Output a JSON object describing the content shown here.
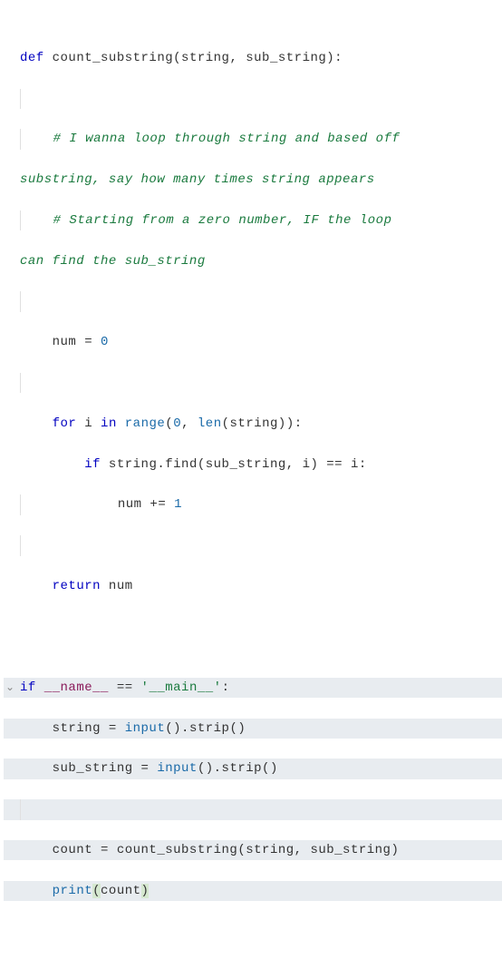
{
  "code": {
    "l1_def": "def",
    "l1_fn": " count_substring",
    "l1_rest": "(string, sub_string):",
    "l2": "",
    "l3a": "    ",
    "l3b": "# I wanna loop through string and based off",
    "l4a": "",
    "l4b": "substring, say how many times string appears",
    "l5a": "    ",
    "l5b": "# Starting from a zero number, IF the loop",
    "l6a": "",
    "l6b": "can find the sub_string",
    "l7": "",
    "l8a": "    num = ",
    "l8b": "0",
    "l9": "",
    "l10a": "    ",
    "l10_for": "for",
    "l10b": " i ",
    "l10_in": "in",
    "l10c": " ",
    "l10_range": "range",
    "l10d": "(",
    "l10e": "0",
    "l10f": ", ",
    "l10_len": "len",
    "l10g": "(string)):",
    "l11a": "        ",
    "l11_if": "if",
    "l11b": " string.find(sub_string, i) == i:",
    "l12a": "            num += ",
    "l12b": "1",
    "l13": "",
    "l14a": "    ",
    "l14_ret": "return",
    "l14b": " num",
    "l15": "",
    "l16_if": "if",
    "l16a": " ",
    "l16_name": "__name__",
    "l16b": " == ",
    "l16_str": "'__main__'",
    "l16c": ":",
    "l17a": "    string = ",
    "l17_input": "input",
    "l17b": "().strip()",
    "l18a": "    sub_string = ",
    "l18_input": "input",
    "l18b": "().strip()",
    "l19": "",
    "l20a": "    count = count_substring(string, sub_string)",
    "l21a": "    ",
    "l21_print": "print",
    "l21_lp": "(",
    "l21b": "count",
    "l21_rp": ")"
  },
  "chevron": "⌄"
}
